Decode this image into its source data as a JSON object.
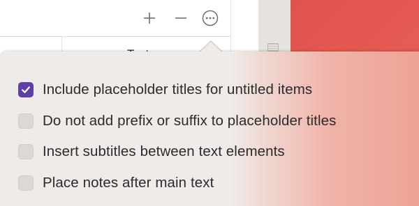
{
  "background": {
    "column_header": "Text"
  },
  "toolbar": {
    "buttons": [
      {
        "name": "plus-icon",
        "glyph": "+"
      },
      {
        "name": "minus-icon",
        "glyph": "−"
      },
      {
        "name": "more-options-icon",
        "glyph": "⋯"
      }
    ]
  },
  "options": [
    {
      "label": "Include placeholder titles for untitled items",
      "checked": true
    },
    {
      "label": "Do not add prefix or suffix to placeholder titles",
      "checked": false
    },
    {
      "label": "Insert subtitles between text elements",
      "checked": false
    },
    {
      "label": "Place notes after main text",
      "checked": false
    }
  ],
  "colors": {
    "checkbox_accent": "#5e3fa3",
    "desktop_red": "#e2524c"
  }
}
